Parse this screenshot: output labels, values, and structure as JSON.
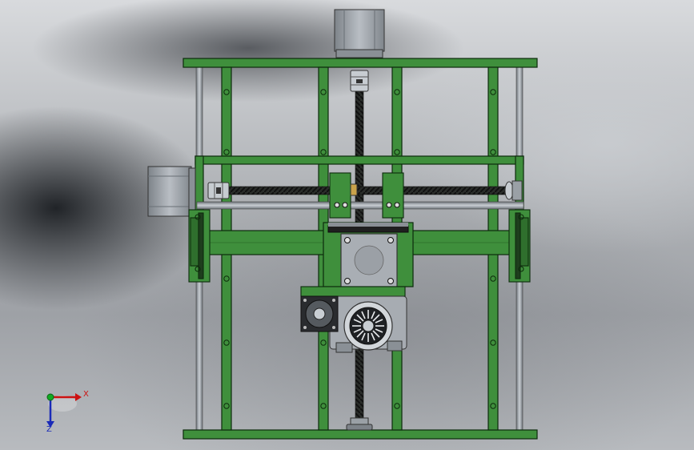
{
  "window": {
    "background_top": "#d8dadd",
    "background_bottom": "#9ea1a6"
  },
  "model": {
    "frame_color": "#3f8f3c",
    "frame_edge": "#0d2a0c",
    "steel_color": "#9aa0a6",
    "motor_color": "#a9aeb4"
  },
  "triad": {
    "x_label": "X",
    "z_label": "Z",
    "x_color": "#cc1111",
    "y_color": "#11aa22",
    "z_color": "#1a2ab8"
  }
}
